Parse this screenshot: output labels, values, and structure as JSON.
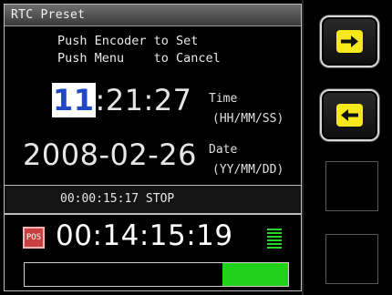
{
  "window": {
    "title": "RTC Preset"
  },
  "instructions": {
    "line1": "Push Encoder to Set",
    "line2": "Push Menu    to Cancel"
  },
  "time": {
    "highlighted": "11",
    "rest": ":21:27",
    "label": "Time",
    "format": "(HH/MM/SS)"
  },
  "date": {
    "value": "2008-02-26",
    "label": "Date",
    "format": "(YY/MM/DD)"
  },
  "status": {
    "text": "00:00:15:17 STOP"
  },
  "position": {
    "badge": "POS",
    "timecode": "00:14:15:19"
  },
  "progress": {
    "fraction": 0.25
  },
  "softkeys": [
    {
      "icon": "arrow-right-icon"
    },
    {
      "icon": "arrow-left-icon"
    },
    {
      "icon": ""
    },
    {
      "icon": ""
    }
  ],
  "colors": {
    "highlight_bg": "#ffffff",
    "highlight_fg": "#2047c6",
    "accent_yellow": "#f6e81a",
    "meter_green": "#2bd42b",
    "pos_red": "#c94040"
  }
}
